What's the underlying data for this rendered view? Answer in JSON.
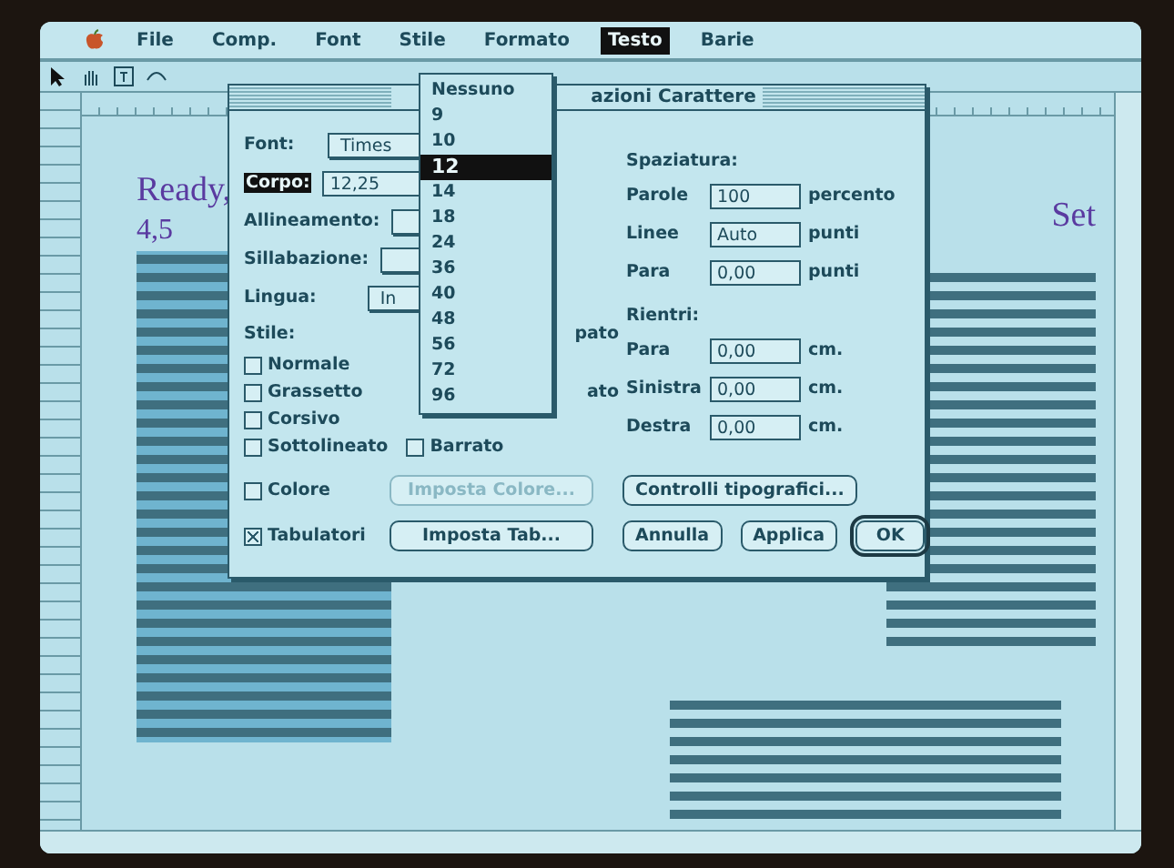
{
  "menu_bar": {
    "items": [
      {
        "label": "File",
        "selected": false
      },
      {
        "label": "Comp.",
        "selected": false
      },
      {
        "label": "Font",
        "selected": false
      },
      {
        "label": "Stile",
        "selected": false
      },
      {
        "label": "Formato",
        "selected": false
      },
      {
        "label": "Testo",
        "selected": true
      },
      {
        "label": "Barie",
        "selected": false
      }
    ]
  },
  "document": {
    "heading_left": "Ready,",
    "version": "4,5",
    "heading_right": "Set"
  },
  "dialog": {
    "title": "azioni Carattere",
    "fields": [
      {
        "label": "Font:",
        "kind": "popup",
        "value": "Times",
        "highlighted": false
      },
      {
        "label": "Corpo:",
        "kind": "text",
        "value": "12,25",
        "highlighted": true
      },
      {
        "label": "Allineamento:",
        "kind": "popup",
        "highlighted": false
      },
      {
        "label": "Sillabazione:",
        "kind": "popup",
        "highlighted": false
      },
      {
        "label": "Lingua:",
        "kind": "popup",
        "value": "In",
        "highlighted": false
      }
    ],
    "style_label": "Stile:",
    "styles": [
      {
        "label": "Normale",
        "checked": false
      },
      {
        "label": "Grassetto",
        "checked": false
      },
      {
        "label": "Corsivo",
        "checked": false
      },
      {
        "label": "Sottolineato",
        "checked": false
      },
      {
        "label": "Barrato",
        "checked": false
      }
    ],
    "partial_labels": [
      "pato",
      "ato"
    ],
    "spacing_label": "Spaziatura:",
    "spacing": [
      {
        "label": "Parole",
        "value": "100",
        "unit": "percento"
      },
      {
        "label": "Linee",
        "value": "Auto",
        "unit": "punti"
      },
      {
        "label": "Para",
        "value": "0,00",
        "unit": "punti"
      }
    ],
    "indent_label": "Rientri:",
    "indents": [
      {
        "label": "Para",
        "value": "0,00",
        "unit": "cm."
      },
      {
        "label": "Sinistra",
        "value": "0,00",
        "unit": "cm."
      },
      {
        "label": "Destra",
        "value": "0,00",
        "unit": "cm."
      }
    ],
    "color": {
      "label": "Colore",
      "checked": false,
      "button": "Imposta Colore...",
      "disabled": true
    },
    "tabs": {
      "label": "Tabulatori",
      "checked": true,
      "button": "Imposta Tab...",
      "disabled": false
    },
    "typo_button": "Controlli tipografici...",
    "buttons": [
      {
        "label": "Annulla",
        "default": false
      },
      {
        "label": "Applica",
        "default": false
      },
      {
        "label": "OK",
        "default": true
      }
    ]
  },
  "size_popup": {
    "items": [
      {
        "label": "Nessuno",
        "selected": false
      },
      {
        "label": "9",
        "selected": false
      },
      {
        "label": "10",
        "selected": false
      },
      {
        "label": "12",
        "selected": true
      },
      {
        "label": "14",
        "selected": false
      },
      {
        "label": "18",
        "selected": false
      },
      {
        "label": "24",
        "selected": false
      },
      {
        "label": "36",
        "selected": false
      },
      {
        "label": "40",
        "selected": false
      },
      {
        "label": "48",
        "selected": false
      },
      {
        "label": "56",
        "selected": false
      },
      {
        "label": "72",
        "selected": false
      },
      {
        "label": "96",
        "selected": false
      }
    ]
  }
}
